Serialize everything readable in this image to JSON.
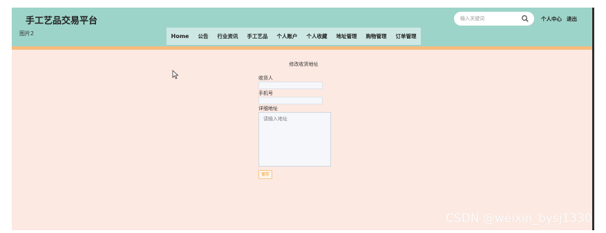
{
  "header": {
    "site_title": "手工艺品交易平台",
    "small_link": "图片2",
    "search_placeholder": "输入关键词",
    "user_center": "个人中心",
    "logout": "退出"
  },
  "nav": {
    "items": [
      {
        "label": "Home"
      },
      {
        "label": "公告"
      },
      {
        "label": "行业资讯"
      },
      {
        "label": "手工艺品"
      },
      {
        "label": "个人账户"
      },
      {
        "label": "个人收藏"
      },
      {
        "label": "地址管理"
      },
      {
        "label": "购物管理"
      },
      {
        "label": "订单管理"
      }
    ]
  },
  "form": {
    "title": "修改收货地址",
    "receiver_label": "收货人",
    "receiver_value": "",
    "phone_label": "手机号",
    "phone_value": "",
    "address_label": "详细地址",
    "address_placeholder": "请输入地址",
    "save_label": "保存"
  },
  "watermark": "CSDN @weixin_bysj1330",
  "colors": {
    "header_bg": "#9dd4c9",
    "nav_bg": "#cde8e4",
    "accent_bar": "#f6bb7d",
    "page_bg": "#fce9e2",
    "save_text": "#f39a35"
  }
}
